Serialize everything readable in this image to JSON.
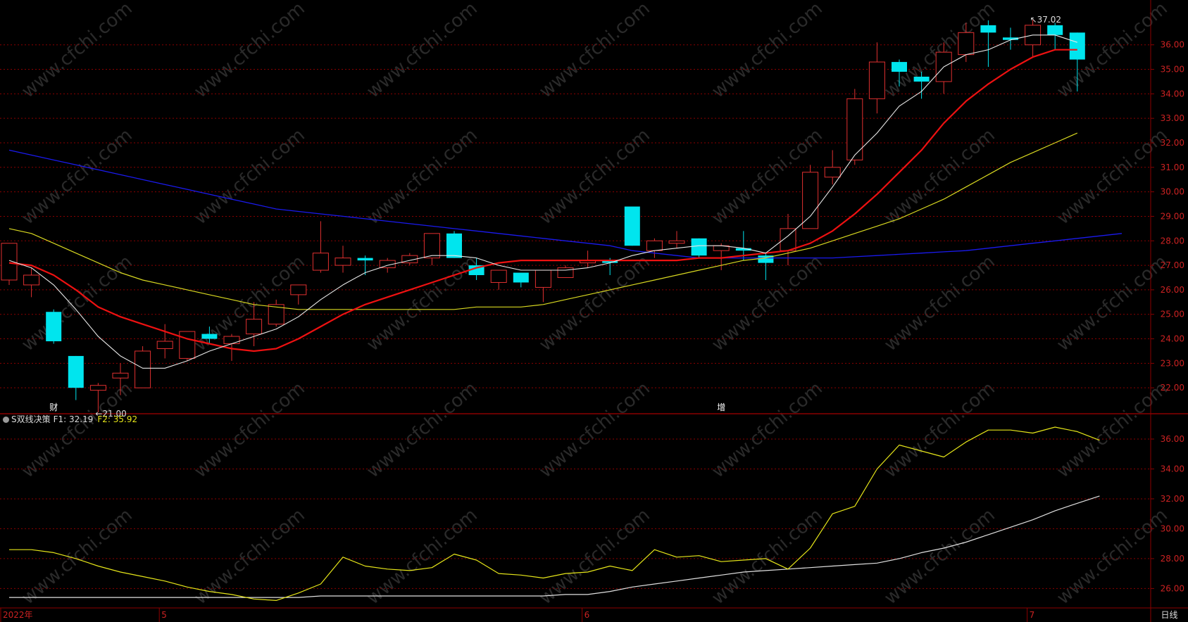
{
  "colors": {
    "background": "#000000",
    "grid": "#8b0000",
    "axis_text": "#cc2222",
    "up_candle": "#e03030",
    "down_candle": "#00e5ee",
    "ma_short": "#e8e8e8",
    "ma_mid": "#ee1111",
    "ma_long": "#d8d820",
    "ma_xlong": "#1a1aee",
    "f1": "#e0e0e0",
    "f2": "#e6e619"
  },
  "watermark": "www.cfchi.com",
  "chart_data": [
    {
      "type": "candlestick",
      "ylim": [
        21.0,
        37.6
      ],
      "yticks": [
        "22.00",
        "23.00",
        "24.00",
        "25.00",
        "26.00",
        "27.00",
        "28.00",
        "29.00",
        "30.00",
        "31.00",
        "32.00",
        "33.00",
        "34.00",
        "35.00",
        "36.00"
      ],
      "x_date_labels": [
        {
          "label": "2022年",
          "index": 0
        },
        {
          "label": "5",
          "index": 7
        },
        {
          "label": "6",
          "index": 26
        },
        {
          "label": "7",
          "index": 46
        }
      ],
      "candles": [
        {
          "o": 26.4,
          "h": 27.9,
          "l": 26.2,
          "c": 27.9
        },
        {
          "o": 26.2,
          "h": 26.9,
          "l": 25.7,
          "c": 26.6
        },
        {
          "o": 25.1,
          "h": 25.2,
          "l": 23.8,
          "c": 23.9
        },
        {
          "o": 23.3,
          "h": 23.3,
          "l": 21.5,
          "c": 22.0
        },
        {
          "o": 21.9,
          "h": 22.2,
          "l": 21.0,
          "c": 22.1
        },
        {
          "o": 22.4,
          "h": 23.0,
          "l": 21.7,
          "c": 22.6
        },
        {
          "o": 22.0,
          "h": 23.7,
          "l": 22.0,
          "c": 23.5
        },
        {
          "o": 23.6,
          "h": 24.6,
          "l": 23.2,
          "c": 23.9
        },
        {
          "o": 23.2,
          "h": 24.3,
          "l": 23.1,
          "c": 24.3
        },
        {
          "o": 24.2,
          "h": 24.5,
          "l": 23.8,
          "c": 24.0
        },
        {
          "o": 23.8,
          "h": 24.2,
          "l": 23.1,
          "c": 24.1
        },
        {
          "o": 24.2,
          "h": 25.5,
          "l": 23.7,
          "c": 24.8
        },
        {
          "o": 24.6,
          "h": 25.6,
          "l": 24.5,
          "c": 25.4
        },
        {
          "o": 25.8,
          "h": 26.2,
          "l": 25.4,
          "c": 26.2
        },
        {
          "o": 26.8,
          "h": 28.8,
          "l": 26.7,
          "c": 27.5
        },
        {
          "o": 27.0,
          "h": 27.8,
          "l": 26.7,
          "c": 27.3
        },
        {
          "o": 27.3,
          "h": 27.4,
          "l": 26.6,
          "c": 27.2
        },
        {
          "o": 26.9,
          "h": 27.3,
          "l": 26.7,
          "c": 27.2
        },
        {
          "o": 27.1,
          "h": 27.5,
          "l": 27.0,
          "c": 27.4
        },
        {
          "o": 27.3,
          "h": 28.3,
          "l": 27.0,
          "c": 28.3
        },
        {
          "o": 28.3,
          "h": 28.4,
          "l": 27.3,
          "c": 27.3
        },
        {
          "o": 27.0,
          "h": 27.3,
          "l": 26.4,
          "c": 26.6
        },
        {
          "o": 26.3,
          "h": 26.8,
          "l": 26.0,
          "c": 26.8
        },
        {
          "o": 26.7,
          "h": 26.7,
          "l": 26.1,
          "c": 26.3
        },
        {
          "o": 26.1,
          "h": 26.8,
          "l": 25.5,
          "c": 26.8
        },
        {
          "o": 26.5,
          "h": 27.0,
          "l": 26.5,
          "c": 26.9
        },
        {
          "o": 27.1,
          "h": 27.6,
          "l": 26.9,
          "c": 27.2
        },
        {
          "o": 27.2,
          "h": 27.3,
          "l": 26.6,
          "c": 27.1
        },
        {
          "o": 29.4,
          "h": 29.4,
          "l": 27.8,
          "c": 27.8
        },
        {
          "o": 27.6,
          "h": 28.1,
          "l": 27.3,
          "c": 28.0
        },
        {
          "o": 27.9,
          "h": 28.4,
          "l": 27.7,
          "c": 28.0
        },
        {
          "o": 28.1,
          "h": 28.1,
          "l": 27.3,
          "c": 27.4
        },
        {
          "o": 27.6,
          "h": 27.9,
          "l": 26.8,
          "c": 27.8
        },
        {
          "o": 27.7,
          "h": 28.4,
          "l": 27.2,
          "c": 27.6
        },
        {
          "o": 27.4,
          "h": 27.5,
          "l": 26.4,
          "c": 27.1
        },
        {
          "o": 27.6,
          "h": 29.1,
          "l": 27.0,
          "c": 28.5
        },
        {
          "o": 28.5,
          "h": 31.1,
          "l": 28.5,
          "c": 30.8
        },
        {
          "o": 30.6,
          "h": 31.7,
          "l": 30.3,
          "c": 31.0
        },
        {
          "o": 31.3,
          "h": 34.2,
          "l": 31.1,
          "c": 33.8
        },
        {
          "o": 33.8,
          "h": 36.1,
          "l": 33.2,
          "c": 35.3
        },
        {
          "o": 35.3,
          "h": 35.4,
          "l": 34.3,
          "c": 34.9
        },
        {
          "o": 34.7,
          "h": 34.9,
          "l": 33.8,
          "c": 34.5
        },
        {
          "o": 34.5,
          "h": 36.1,
          "l": 34.0,
          "c": 35.7
        },
        {
          "o": 35.6,
          "h": 36.9,
          "l": 35.3,
          "c": 36.5
        },
        {
          "o": 36.8,
          "h": 37.0,
          "l": 35.1,
          "c": 36.5
        },
        {
          "o": 36.3,
          "h": 36.7,
          "l": 35.8,
          "c": 36.2
        },
        {
          "o": 36.0,
          "h": 37.02,
          "l": 35.5,
          "c": 36.8
        },
        {
          "o": 36.8,
          "h": 36.9,
          "l": 35.8,
          "c": 36.4
        },
        {
          "o": 36.5,
          "h": 36.5,
          "l": 34.1,
          "c": 35.4
        }
      ],
      "ma_short": [
        27.2,
        26.9,
        26.2,
        25.2,
        24.1,
        23.3,
        22.8,
        22.8,
        23.1,
        23.5,
        23.8,
        24.1,
        24.4,
        24.9,
        25.6,
        26.2,
        26.7,
        27.0,
        27.2,
        27.4,
        27.4,
        27.3,
        27.0,
        26.8,
        26.8,
        26.8,
        26.9,
        27.1,
        27.4,
        27.6,
        27.7,
        27.8,
        27.8,
        27.7,
        27.5,
        28.2,
        29.0,
        30.2,
        31.5,
        32.4,
        33.5,
        34.1,
        35.1,
        35.6,
        35.8,
        36.2,
        36.4,
        36.4,
        36.1
      ],
      "ma_mid": [
        27.1,
        27.0,
        26.6,
        26.0,
        25.3,
        24.9,
        24.6,
        24.3,
        24.0,
        23.8,
        23.6,
        23.5,
        23.6,
        24.0,
        24.5,
        25.0,
        25.4,
        25.7,
        26.0,
        26.3,
        26.6,
        26.9,
        27.1,
        27.2,
        27.2,
        27.2,
        27.2,
        27.2,
        27.2,
        27.2,
        27.2,
        27.3,
        27.3,
        27.4,
        27.5,
        27.6,
        27.9,
        28.4,
        29.1,
        29.9,
        30.8,
        31.7,
        32.8,
        33.7,
        34.4,
        35.0,
        35.5,
        35.8,
        35.8
      ],
      "ma_long": [
        28.5,
        28.3,
        27.9,
        27.5,
        27.1,
        26.7,
        26.4,
        26.2,
        26.0,
        25.8,
        25.6,
        25.4,
        25.3,
        25.2,
        25.2,
        25.2,
        25.2,
        25.2,
        25.2,
        25.2,
        25.2,
        25.3,
        25.3,
        25.3,
        25.4,
        25.6,
        25.8,
        26.0,
        26.2,
        26.4,
        26.6,
        26.8,
        27.0,
        27.2,
        27.3,
        27.5,
        27.7,
        28.0,
        28.3,
        28.6,
        28.9,
        29.3,
        29.7,
        30.2,
        30.7,
        31.2,
        31.6,
        32.0,
        32.4
      ],
      "ma_xlong": [
        31.7,
        31.5,
        31.3,
        31.1,
        30.9,
        30.7,
        30.5,
        30.3,
        30.1,
        29.9,
        29.7,
        29.5,
        29.3,
        29.2,
        29.1,
        29.0,
        28.9,
        28.8,
        28.7,
        28.6,
        28.5,
        28.4,
        28.3,
        28.2,
        28.1,
        28.0,
        27.9,
        27.8,
        27.6,
        27.5,
        27.4,
        27.3,
        27.3,
        27.3,
        27.3,
        27.3,
        27.3,
        27.3,
        27.35,
        27.4,
        27.45,
        27.5,
        27.55,
        27.6,
        27.7,
        27.8,
        27.9,
        28.0,
        28.1,
        28.2,
        28.3
      ],
      "annotations": [
        {
          "text": "←21.00",
          "index": 4,
          "value": 21.0
        },
        {
          "text": "↖37.02",
          "index": 46,
          "value": 37.02
        }
      ],
      "event_markers": [
        {
          "text": "财",
          "index": 2
        },
        {
          "text": "增",
          "index": 32
        }
      ]
    },
    {
      "type": "line",
      "name": "S双线决策",
      "ylim": [
        24.7,
        37.6
      ],
      "yticks": [
        "26.00",
        "28.00",
        "30.00",
        "32.00",
        "34.00",
        "36.00"
      ],
      "series": [
        {
          "name": "F1",
          "latest": "32.19",
          "values": [
            25.4,
            25.4,
            25.4,
            25.4,
            25.4,
            25.4,
            25.4,
            25.4,
            25.4,
            25.4,
            25.4,
            25.4,
            25.4,
            25.4,
            25.5,
            25.5,
            25.5,
            25.5,
            25.5,
            25.5,
            25.5,
            25.5,
            25.5,
            25.5,
            25.5,
            25.6,
            25.6,
            25.8,
            26.1,
            26.3,
            26.5,
            26.7,
            26.9,
            27.1,
            27.2,
            27.3,
            27.4,
            27.5,
            27.6,
            27.7,
            28.0,
            28.4,
            28.7,
            29.1,
            29.6,
            30.1,
            30.6,
            31.2,
            31.7,
            32.19
          ]
        },
        {
          "name": "F2",
          "latest": "35.92",
          "values": [
            28.6,
            28.6,
            28.4,
            28.0,
            27.5,
            27.1,
            26.8,
            26.5,
            26.1,
            25.8,
            25.6,
            25.3,
            25.2,
            25.7,
            26.3,
            28.1,
            27.5,
            27.3,
            27.2,
            27.4,
            28.3,
            27.9,
            27.0,
            26.9,
            26.7,
            27.0,
            27.1,
            27.5,
            27.2,
            28.6,
            28.1,
            28.2,
            27.8,
            27.9,
            28.0,
            27.3,
            28.7,
            31.0,
            31.5,
            34.0,
            35.6,
            35.2,
            34.8,
            35.8,
            36.6,
            36.6,
            36.4,
            36.8,
            36.5,
            35.92
          ]
        }
      ]
    }
  ],
  "indicator": {
    "name": "S双线决策",
    "f1_label": "F1: 32.19",
    "f2_label": "F2: 35.92"
  },
  "period_label": "日线"
}
